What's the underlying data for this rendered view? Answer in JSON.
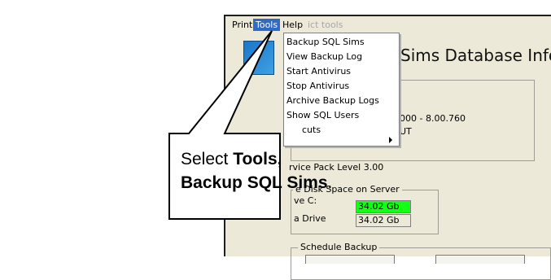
{
  "menubar": {
    "items": [
      {
        "label": "Print"
      },
      {
        "label": "Tools"
      },
      {
        "label": "Help"
      },
      {
        "label": "ict tools"
      }
    ]
  },
  "app": {
    "title": "Sims Database Info",
    "info_lines": [
      "000 - 8.00.760",
      "UT",
      "rvice Pack Level 3.00"
    ],
    "disk": {
      "legend": "e Disk Space on Server",
      "rows": [
        {
          "label": "ve C:",
          "value": "34.02 Gb"
        },
        {
          "label": "a Drive",
          "value": "34.02 Gb"
        }
      ]
    },
    "schedule_legend": "Schedule Backup"
  },
  "tools_menu": {
    "items": [
      "Backup SQL Sims",
      "View Backup Log",
      "Start Antivirus",
      "Stop Antivirus",
      "Archive Backup Logs",
      "Show SQL Users",
      "cuts"
    ]
  },
  "callout": {
    "prefix": "Select ",
    "bold1": "Tools, Backup SQL Sims",
    "suffix": "."
  },
  "colors": {
    "menu_highlight": "#316ac5",
    "disk_ok": "#13ff13"
  }
}
